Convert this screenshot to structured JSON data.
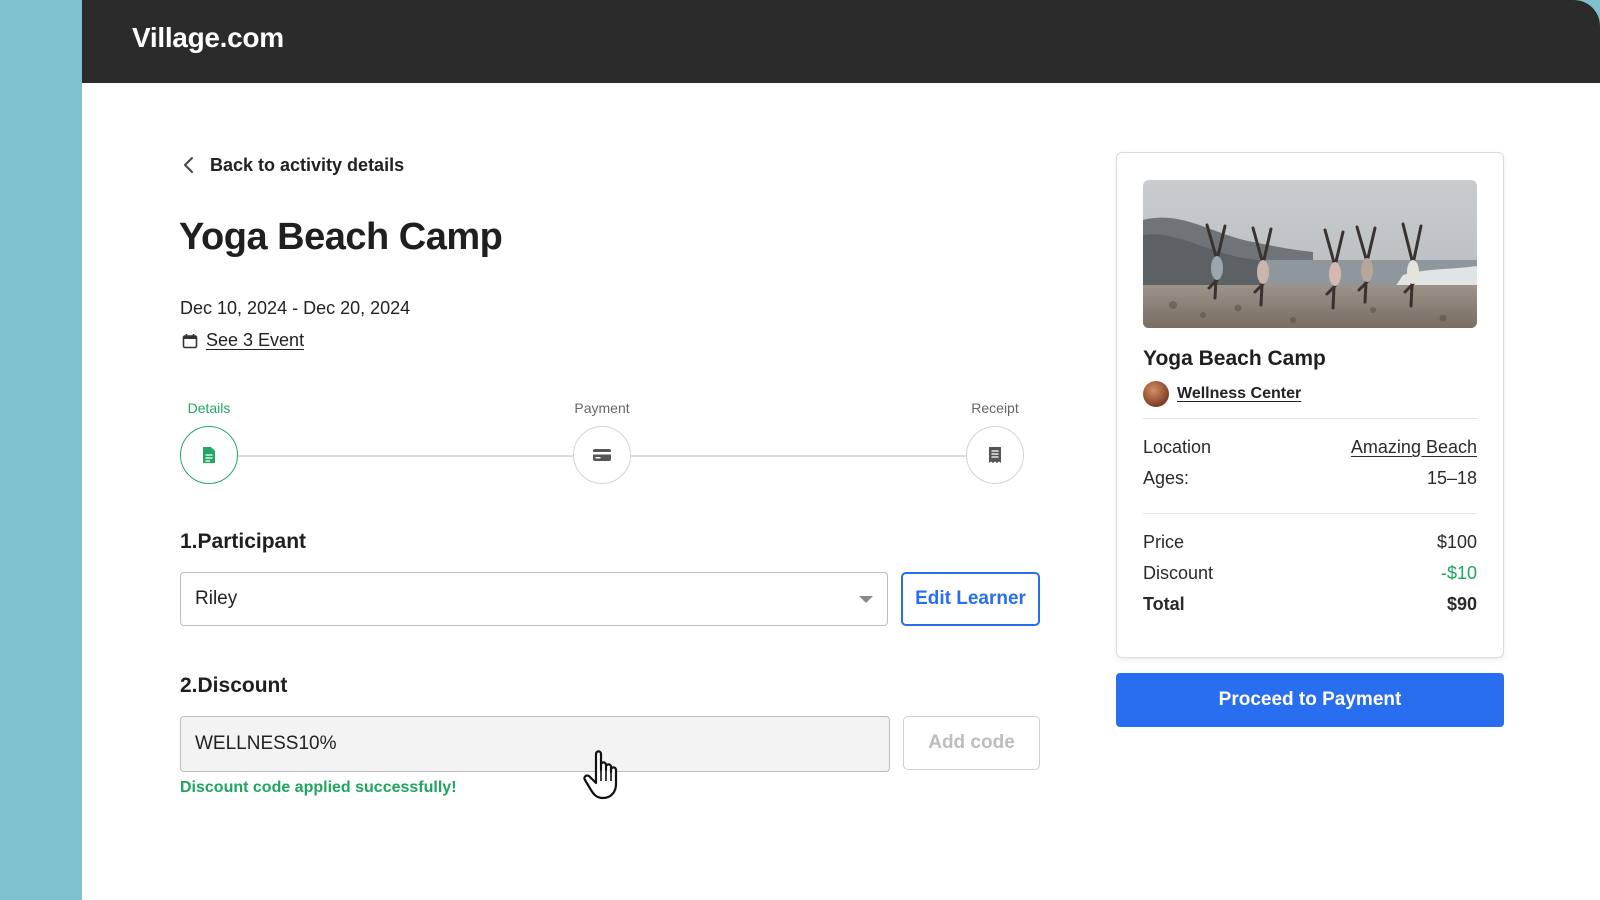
{
  "header": {
    "brand": "Village.com"
  },
  "nav": {
    "back_label": "Back to activity details",
    "back_icon": "chevron-left-icon"
  },
  "activity": {
    "title": "Yoga Beach Camp",
    "dates": "Dec 10, 2024 - Dec 20, 2024",
    "event_link": "See 3 Event",
    "event_icon": "calendar-icon"
  },
  "stepper": {
    "steps": [
      {
        "label": "Details",
        "icon": "document-icon",
        "active": true
      },
      {
        "label": "Payment",
        "icon": "credit-card-icon",
        "active": false
      },
      {
        "label": "Receipt",
        "icon": "receipt-icon",
        "active": false
      }
    ]
  },
  "participant": {
    "section_title": "1.Participant",
    "selected": "Riley",
    "edit_label": "Edit Learner"
  },
  "discount": {
    "section_title": "2.Discount",
    "code_value": "WELLNESS10%",
    "add_label": "Add code",
    "success_message": "Discount code applied successfully!"
  },
  "summary": {
    "title": "Yoga Beach Camp",
    "organizer": "Wellness Center",
    "location_label": "Location",
    "location_value": "Amazing Beach",
    "ages_label": "Ages:",
    "ages_value": "15–18",
    "price_label": "Price",
    "price_value": "$100",
    "discount_label": "Discount",
    "discount_value": "-$10",
    "total_label": "Total",
    "total_value": "$90"
  },
  "cta": {
    "proceed_label": "Proceed to Payment"
  },
  "colors": {
    "accent_blue": "#2a6ef0",
    "success_green": "#1fa560",
    "topbar": "#2b2b2b",
    "side_teal": "#7fc1cf"
  }
}
